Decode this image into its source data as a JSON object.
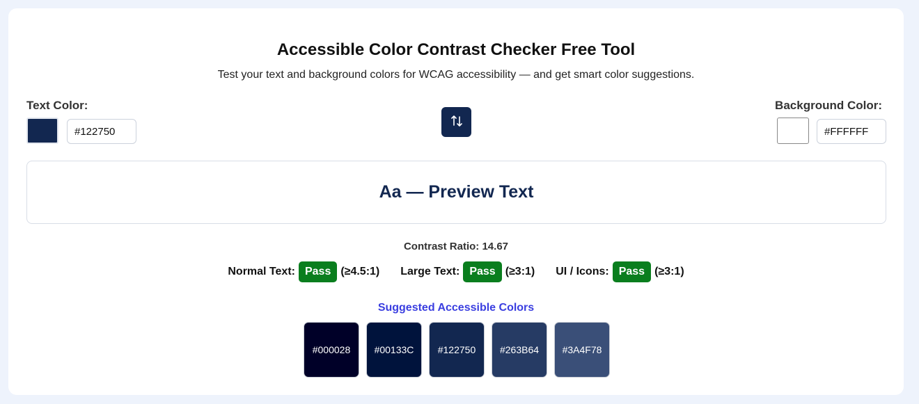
{
  "header": {
    "title": "Accessible Color Contrast Checker Free Tool",
    "subtitle": "Test your text and background colors for WCAG accessibility — and get smart color suggestions."
  },
  "text_color": {
    "label": "Text Color:",
    "value": "#122750",
    "swatch_color": "#122750"
  },
  "background_color": {
    "label": "Background Color:",
    "value": "#FFFFFF",
    "swatch_color": "#FFFFFF"
  },
  "swap_button": {
    "icon": "swap-vertical-arrows-icon"
  },
  "preview": {
    "text": "Aa — Preview Text",
    "text_color": "#122750",
    "background_color": "#FFFFFF"
  },
  "contrast": {
    "text": "Contrast Ratio: 14.67"
  },
  "results": [
    {
      "label": "Normal Text:",
      "status": "Pass",
      "threshold": "(≥4.5:1)"
    },
    {
      "label": "Large Text:",
      "status": "Pass",
      "threshold": "(≥3:1)"
    },
    {
      "label": "UI / Icons:",
      "status": "Pass",
      "threshold": "(≥3:1)"
    }
  ],
  "suggestions": {
    "title": "Suggested Accessible Colors",
    "colors": [
      "#000028",
      "#00133C",
      "#122750",
      "#263B64",
      "#3A4F78"
    ]
  },
  "colors": {
    "pass": "#0a7e1e",
    "accent": "#3a3ee0",
    "page_bg": "#eef3fc"
  }
}
